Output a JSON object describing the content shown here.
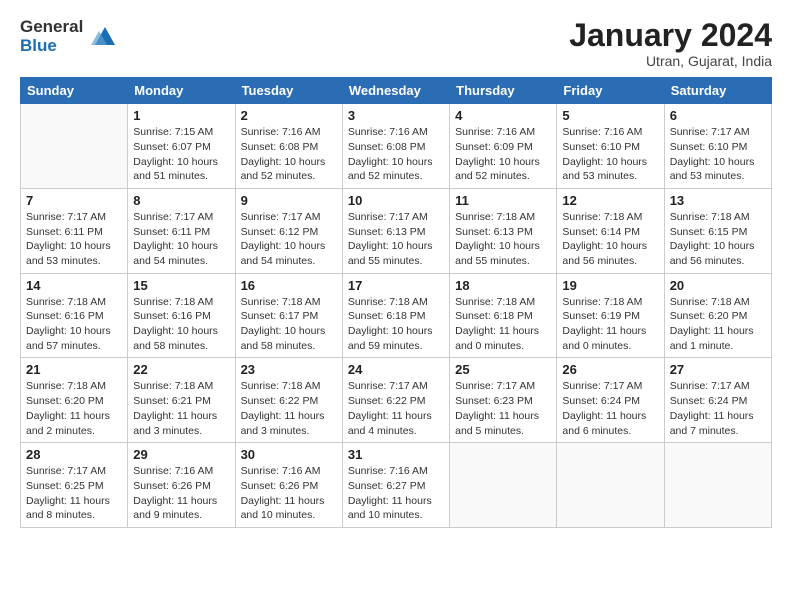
{
  "logo": {
    "general": "General",
    "blue": "Blue"
  },
  "title": "January 2024",
  "location": "Utran, Gujarat, India",
  "headers": [
    "Sunday",
    "Monday",
    "Tuesday",
    "Wednesday",
    "Thursday",
    "Friday",
    "Saturday"
  ],
  "weeks": [
    [
      {
        "day": "",
        "info": ""
      },
      {
        "day": "1",
        "info": "Sunrise: 7:15 AM\nSunset: 6:07 PM\nDaylight: 10 hours\nand 51 minutes."
      },
      {
        "day": "2",
        "info": "Sunrise: 7:16 AM\nSunset: 6:08 PM\nDaylight: 10 hours\nand 52 minutes."
      },
      {
        "day": "3",
        "info": "Sunrise: 7:16 AM\nSunset: 6:08 PM\nDaylight: 10 hours\nand 52 minutes."
      },
      {
        "day": "4",
        "info": "Sunrise: 7:16 AM\nSunset: 6:09 PM\nDaylight: 10 hours\nand 52 minutes."
      },
      {
        "day": "5",
        "info": "Sunrise: 7:16 AM\nSunset: 6:10 PM\nDaylight: 10 hours\nand 53 minutes."
      },
      {
        "day": "6",
        "info": "Sunrise: 7:17 AM\nSunset: 6:10 PM\nDaylight: 10 hours\nand 53 minutes."
      }
    ],
    [
      {
        "day": "7",
        "info": "Sunrise: 7:17 AM\nSunset: 6:11 PM\nDaylight: 10 hours\nand 53 minutes."
      },
      {
        "day": "8",
        "info": "Sunrise: 7:17 AM\nSunset: 6:11 PM\nDaylight: 10 hours\nand 54 minutes."
      },
      {
        "day": "9",
        "info": "Sunrise: 7:17 AM\nSunset: 6:12 PM\nDaylight: 10 hours\nand 54 minutes."
      },
      {
        "day": "10",
        "info": "Sunrise: 7:17 AM\nSunset: 6:13 PM\nDaylight: 10 hours\nand 55 minutes."
      },
      {
        "day": "11",
        "info": "Sunrise: 7:18 AM\nSunset: 6:13 PM\nDaylight: 10 hours\nand 55 minutes."
      },
      {
        "day": "12",
        "info": "Sunrise: 7:18 AM\nSunset: 6:14 PM\nDaylight: 10 hours\nand 56 minutes."
      },
      {
        "day": "13",
        "info": "Sunrise: 7:18 AM\nSunset: 6:15 PM\nDaylight: 10 hours\nand 56 minutes."
      }
    ],
    [
      {
        "day": "14",
        "info": "Sunrise: 7:18 AM\nSunset: 6:16 PM\nDaylight: 10 hours\nand 57 minutes."
      },
      {
        "day": "15",
        "info": "Sunrise: 7:18 AM\nSunset: 6:16 PM\nDaylight: 10 hours\nand 58 minutes."
      },
      {
        "day": "16",
        "info": "Sunrise: 7:18 AM\nSunset: 6:17 PM\nDaylight: 10 hours\nand 58 minutes."
      },
      {
        "day": "17",
        "info": "Sunrise: 7:18 AM\nSunset: 6:18 PM\nDaylight: 10 hours\nand 59 minutes."
      },
      {
        "day": "18",
        "info": "Sunrise: 7:18 AM\nSunset: 6:18 PM\nDaylight: 11 hours\nand 0 minutes."
      },
      {
        "day": "19",
        "info": "Sunrise: 7:18 AM\nSunset: 6:19 PM\nDaylight: 11 hours\nand 0 minutes."
      },
      {
        "day": "20",
        "info": "Sunrise: 7:18 AM\nSunset: 6:20 PM\nDaylight: 11 hours\nand 1 minute."
      }
    ],
    [
      {
        "day": "21",
        "info": "Sunrise: 7:18 AM\nSunset: 6:20 PM\nDaylight: 11 hours\nand 2 minutes."
      },
      {
        "day": "22",
        "info": "Sunrise: 7:18 AM\nSunset: 6:21 PM\nDaylight: 11 hours\nand 3 minutes."
      },
      {
        "day": "23",
        "info": "Sunrise: 7:18 AM\nSunset: 6:22 PM\nDaylight: 11 hours\nand 3 minutes."
      },
      {
        "day": "24",
        "info": "Sunrise: 7:17 AM\nSunset: 6:22 PM\nDaylight: 11 hours\nand 4 minutes."
      },
      {
        "day": "25",
        "info": "Sunrise: 7:17 AM\nSunset: 6:23 PM\nDaylight: 11 hours\nand 5 minutes."
      },
      {
        "day": "26",
        "info": "Sunrise: 7:17 AM\nSunset: 6:24 PM\nDaylight: 11 hours\nand 6 minutes."
      },
      {
        "day": "27",
        "info": "Sunrise: 7:17 AM\nSunset: 6:24 PM\nDaylight: 11 hours\nand 7 minutes."
      }
    ],
    [
      {
        "day": "28",
        "info": "Sunrise: 7:17 AM\nSunset: 6:25 PM\nDaylight: 11 hours\nand 8 minutes."
      },
      {
        "day": "29",
        "info": "Sunrise: 7:16 AM\nSunset: 6:26 PM\nDaylight: 11 hours\nand 9 minutes."
      },
      {
        "day": "30",
        "info": "Sunrise: 7:16 AM\nSunset: 6:26 PM\nDaylight: 11 hours\nand 10 minutes."
      },
      {
        "day": "31",
        "info": "Sunrise: 7:16 AM\nSunset: 6:27 PM\nDaylight: 11 hours\nand 10 minutes."
      },
      {
        "day": "",
        "info": ""
      },
      {
        "day": "",
        "info": ""
      },
      {
        "day": "",
        "info": ""
      }
    ]
  ]
}
